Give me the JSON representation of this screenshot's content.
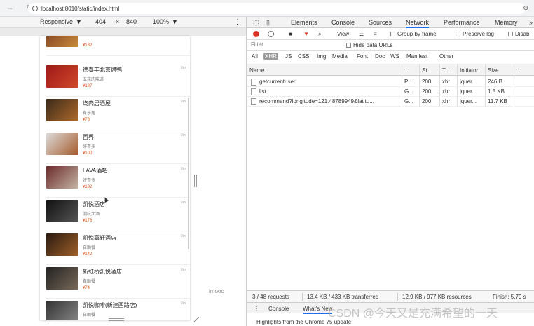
{
  "browser": {
    "url": "localhost:8010/static/index.html"
  },
  "device": {
    "name": "Responsive",
    "width": "404",
    "times": "×",
    "height": "840",
    "zoom": "100%"
  },
  "phone": {
    "items": [
      {
        "name": "",
        "tag": "",
        "price": "¥132",
        "dist": "",
        "colors": [
          "#7a3b1e",
          "#c98a3c"
        ]
      },
      {
        "name": "德泰丰北京烤鸭",
        "tag": "五花肉味道",
        "price": "¥187",
        "dist": "0m",
        "colors": [
          "#a01818",
          "#d04a2a"
        ]
      },
      {
        "name": "烧肉居酒屋",
        "tag": "有乐居",
        "price": "¥78",
        "dist": "0m",
        "colors": [
          "#3a2a1a",
          "#b06a2a"
        ]
      },
      {
        "name": "西界",
        "tag": "好哥多",
        "price": "¥100",
        "dist": "0m",
        "colors": [
          "#ddd",
          "#a55a2a"
        ]
      },
      {
        "name": "LAVA酒吧",
        "tag": "好哥多",
        "price": "¥132",
        "dist": "0m",
        "colors": [
          "#6b2a2a",
          "#c5b5a5"
        ]
      },
      {
        "name": "凯悦酒店",
        "tag": "澳杭大酒",
        "price": "¥176",
        "dist": "0m",
        "colors": [
          "#111",
          "#555"
        ]
      },
      {
        "name": "凯悦嘉轩酒店",
        "tag": "自助餐",
        "price": "¥142",
        "dist": "0m",
        "colors": [
          "#2a1a10",
          "#a0602a"
        ]
      },
      {
        "name": "新虹桥凯悦酒店",
        "tag": "自助餐",
        "price": "¥74",
        "dist": "0m",
        "colors": [
          "#222",
          "#7a6a5a"
        ]
      },
      {
        "name": "凯悦咖啡(新建西路店)",
        "tag": "自助餐",
        "price": "",
        "dist": "0m",
        "colors": [
          "#333",
          "#888"
        ]
      }
    ]
  },
  "side": {
    "imooc": "imooc"
  },
  "devtools": {
    "tabs": [
      "Elements",
      "Console",
      "Sources",
      "Network",
      "Performance",
      "Memory",
      "»"
    ],
    "toolbar": {
      "view": "View:",
      "group": "Group by frame",
      "preserve": "Preserve log",
      "disable": "Disab"
    },
    "filter": {
      "placeholder": "Filter",
      "hide_data": "Hide data URLs"
    },
    "types": [
      "All",
      "XHR",
      "JS",
      "CSS",
      "Img",
      "Media",
      "Font",
      "Doc",
      "WS",
      "Manifest",
      "Other"
    ],
    "columns": [
      "Name",
      "...",
      "St...",
      "T...",
      "Initiator",
      "Size",
      "..."
    ],
    "rows": [
      {
        "name": "getcurrentuser",
        "m": "P...",
        "status": "200",
        "type": "xhr",
        "init": "jquer...",
        "size": "246 B",
        "t": ""
      },
      {
        "name": "list",
        "m": "G...",
        "status": "200",
        "type": "xhr",
        "init": "jquer...",
        "size": "1.5 KB",
        "t": ""
      },
      {
        "name": "recommend?longitude=121.48789949&latitu...",
        "m": "G...",
        "status": "200",
        "type": "xhr",
        "init": "jquer...",
        "size": "11.7 KB",
        "t": ""
      }
    ],
    "summary": {
      "requests": "3 / 48 requests",
      "transferred": "13.4 KB / 433 KB transferred",
      "resources": "12.9 KB / 977 KB resources",
      "finish": "Finish: 5.79 s"
    },
    "drawer": {
      "console": "Console",
      "whatsnew": "What's New"
    },
    "highlights": "Highlights from the Chrome 75 update"
  },
  "watermark": "CSDN @今天又是充满希望的一天"
}
